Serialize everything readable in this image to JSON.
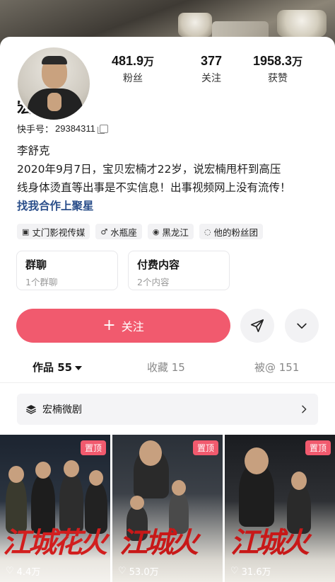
{
  "stats": [
    {
      "value": "481.9",
      "unit": "万",
      "label": "粉丝"
    },
    {
      "value": "377",
      "unit": "",
      "label": "关注"
    },
    {
      "value": "1958.3",
      "unit": "万",
      "label": "获赞"
    }
  ],
  "profile": {
    "name": "宏楠",
    "kuaishou_label": "快手号：",
    "kuaishou_id": "29384311",
    "bio_line1": "李舒克",
    "bio_line2": "2020年9月7日，宝贝宏楠才22岁，说宏楠甩杆到高压",
    "bio_line3": "线身体烫直等出事是不实信息！出事视频网上没有流传！",
    "bio_link": "找我合作上聚星"
  },
  "tags": [
    {
      "icon": "media-icon",
      "glyph": "▣",
      "label": "丈门影视传媒"
    },
    {
      "icon": "male-icon",
      "glyph": "♂",
      "label": "水瓶座"
    },
    {
      "icon": "location-icon",
      "glyph": "◉",
      "label": "黑龙江"
    },
    {
      "icon": "fan-group-icon",
      "glyph": "◌",
      "label": "他的粉丝团"
    }
  ],
  "boxes": [
    {
      "title": "群聊",
      "sub": "1个群聊"
    },
    {
      "title": "付费内容",
      "sub": "2个内容"
    }
  ],
  "actions": {
    "follow_label": "关注"
  },
  "tabs": [
    {
      "label": "作品 55"
    },
    {
      "label": "收藏 15"
    },
    {
      "label": "被@ 151"
    }
  ],
  "collection": {
    "label": "宏楠微剧"
  },
  "videos": [
    {
      "pin": "置顶",
      "title": "江城花火",
      "likes": "4.4万"
    },
    {
      "pin": "置顶",
      "title": "江城火",
      "likes": "53.0万"
    },
    {
      "pin": "置顶",
      "title": "江城火",
      "likes": "31.6万"
    }
  ],
  "colors": {
    "accent": "#f15a6e",
    "link": "#2a4e8a"
  }
}
